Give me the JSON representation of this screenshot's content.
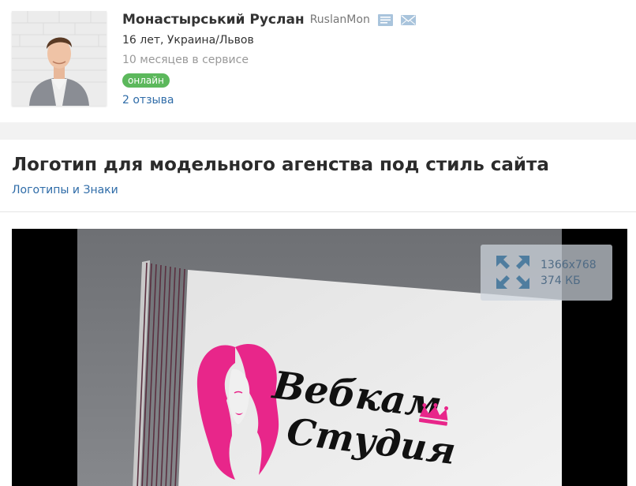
{
  "profile": {
    "full_name": "Монастырський Руслан",
    "username": "RuslanMon",
    "age_location": "16 лет, Украина/Львов",
    "service_time": "10 месяцев в сервисе",
    "status": "онлайн",
    "reviews": "2 отзыва",
    "icons": [
      "message-icon",
      "mail-icon"
    ]
  },
  "project": {
    "title": "Логотип для модельного агенства под стиль сайта",
    "category": "Логотипы и Знаки"
  },
  "image": {
    "resolution": "1366x768",
    "size": "374 КБ",
    "logo_line1": "Вебкам",
    "logo_line2": "Студия"
  },
  "colors": {
    "link": "#2f6ca8",
    "online": "#5cb85c",
    "logo_pink": "#e8268a",
    "icon_blue": "#a9c4dc"
  }
}
